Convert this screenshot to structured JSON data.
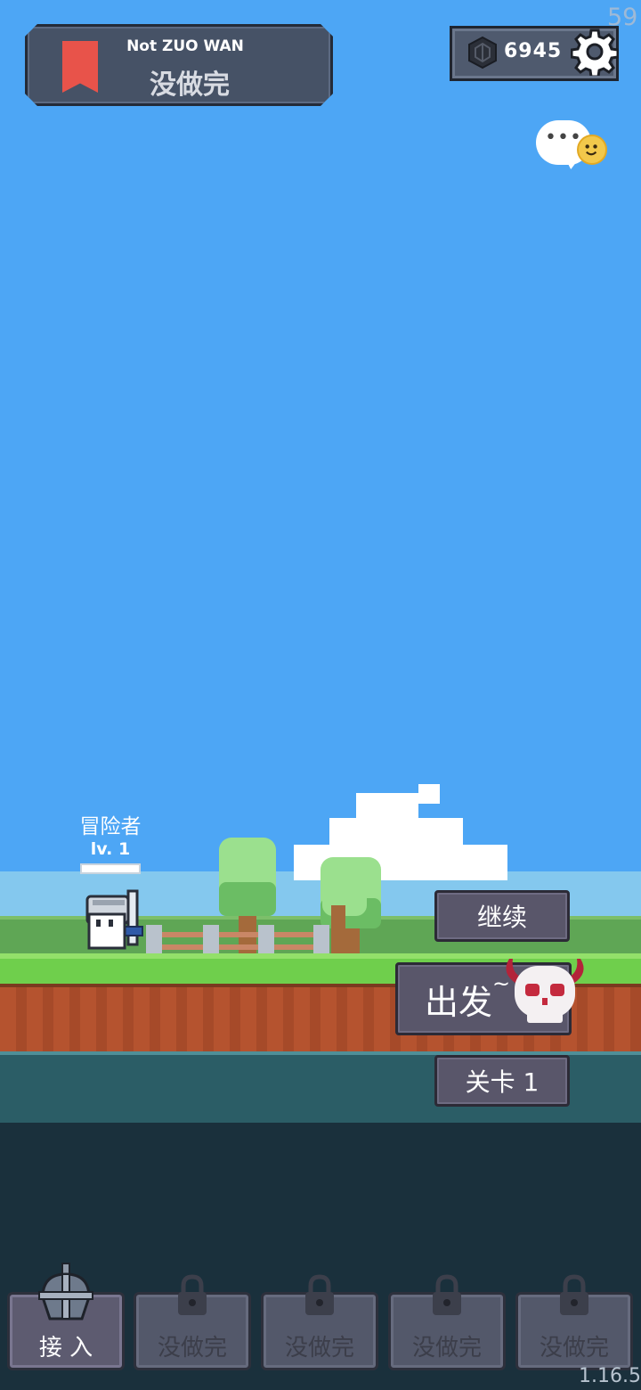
{
  "hud": {
    "fps": "59",
    "title_en": "Not ZUO WAN",
    "title_cn": "没做完",
    "currency": "6945",
    "version": "1.16.5",
    "chat_dots": "•••"
  },
  "hero": {
    "name": "冒险者",
    "level": "lv. 1"
  },
  "actions": {
    "continue": "继续",
    "depart": "出发",
    "tilde": "~",
    "stage": "关卡 1"
  },
  "tabs": [
    {
      "label": "接 入",
      "active": true
    },
    {
      "label": "没做完",
      "locked": true
    },
    {
      "label": "没做完",
      "locked": true
    },
    {
      "label": "没做完",
      "locked": true
    },
    {
      "label": "没做完",
      "locked": true
    }
  ],
  "colors": {
    "sky": "#4da6f5",
    "bookmark": "#e8534a",
    "button": "#59566a",
    "grass": "#6fcf4c",
    "dirt": "#b5532f"
  },
  "icons": [
    "bookmark-icon",
    "gem-icon",
    "gear-icon",
    "chat-icon",
    "smiley-icon",
    "skull-icon",
    "helmet-icon",
    "lock-icon"
  ]
}
